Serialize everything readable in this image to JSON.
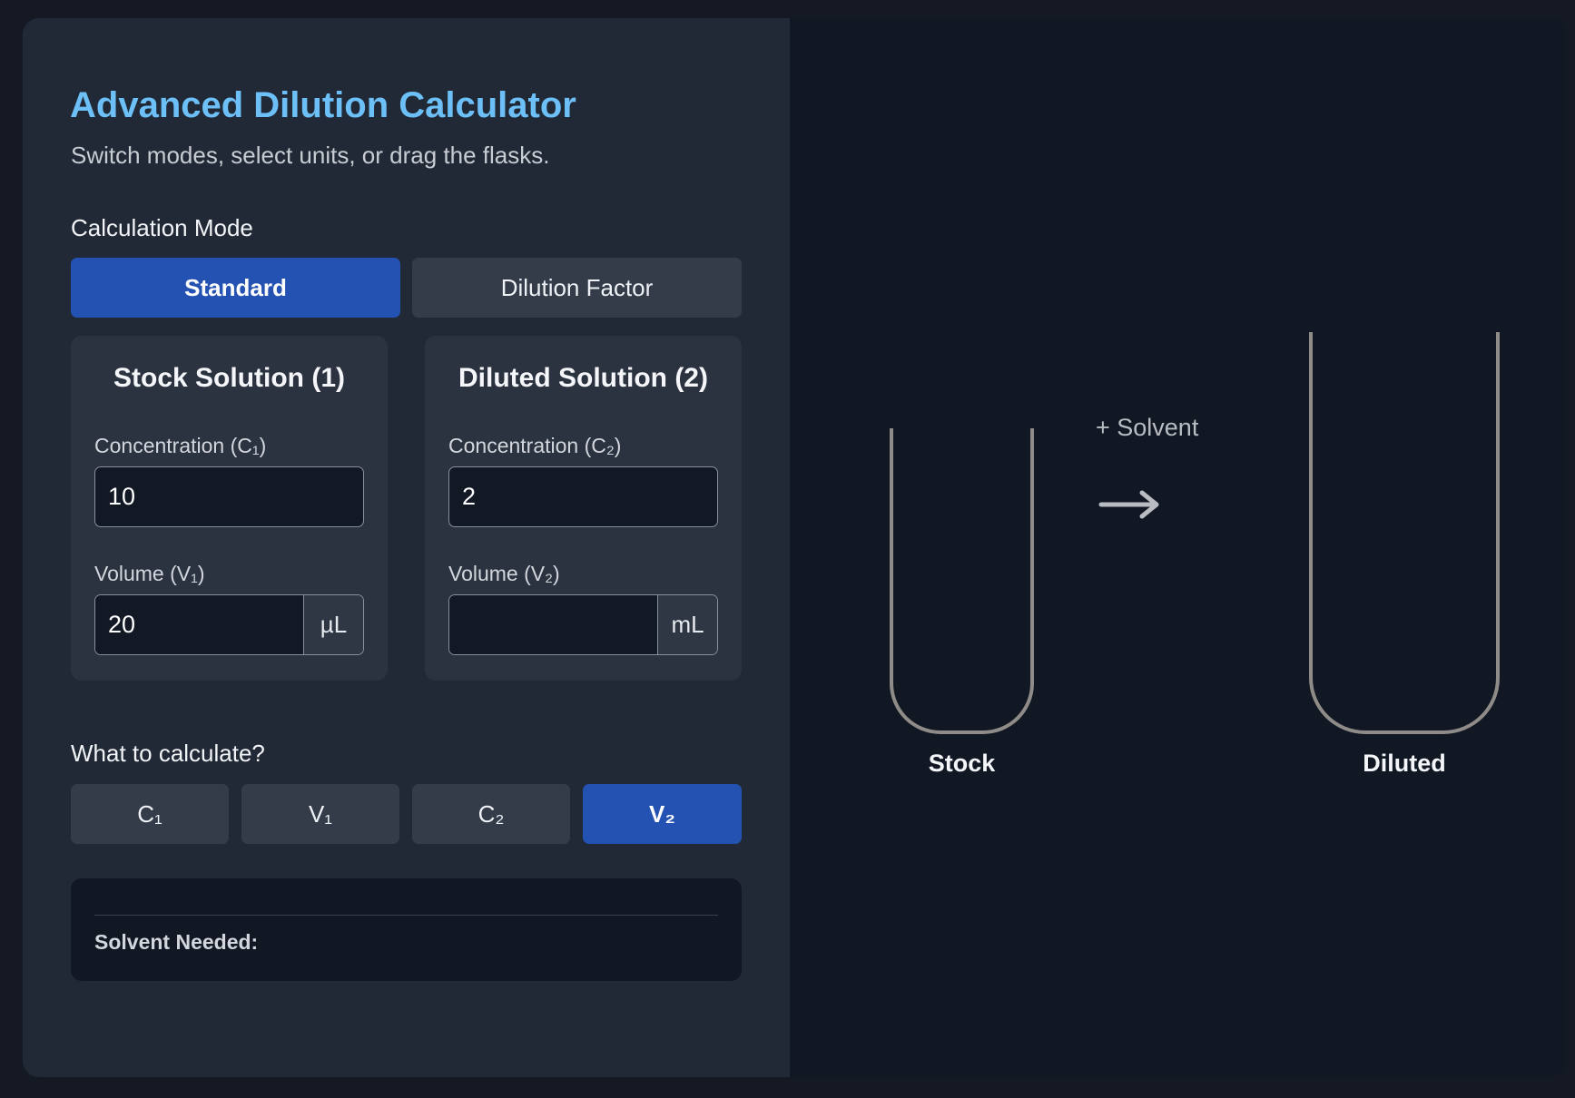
{
  "header": {
    "title": "Advanced Dilution Calculator",
    "subtitle": "Switch modes, select units, or drag the flasks."
  },
  "mode": {
    "label": "Calculation Mode",
    "options": [
      "Standard",
      "Dilution Factor"
    ],
    "selected": "Standard"
  },
  "stock": {
    "title": "Stock Solution (1)",
    "concentration_label": "Concentration (C₁)",
    "concentration_value": "10",
    "volume_label": "Volume (V₁)",
    "volume_value": "20",
    "volume_unit": "µL"
  },
  "diluted": {
    "title": "Diluted Solution (2)",
    "concentration_label": "Concentration (C₂)",
    "concentration_value": "2",
    "volume_label": "Volume (V₂)",
    "volume_value": "",
    "volume_unit": "mL"
  },
  "calculate": {
    "label": "What to calculate?",
    "options": [
      "C₁",
      "V₁",
      "C₂",
      "V₂"
    ],
    "selected": "V₂"
  },
  "result": {
    "solvent_label": "Solvent Needed:"
  },
  "visual": {
    "solvent_text": "+ Solvent",
    "arrow_icon": "right-arrow-icon",
    "stock_label": "Stock",
    "diluted_label": "Diluted"
  },
  "colors": {
    "accent": "#2452b2",
    "title": "#6cc0f7",
    "flask_outline": "#8f8b88"
  }
}
